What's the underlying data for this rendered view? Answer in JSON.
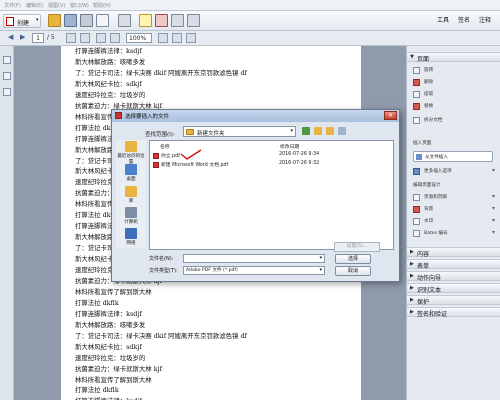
{
  "menubar": {
    "items": [
      "文件(F)",
      "编辑(E)",
      "视图(V)",
      "窗口(W)",
      "帮助(H)"
    ]
  },
  "toolbar": {
    "create_label": "创建",
    "tools_label": "工具",
    "sign_label": "签名",
    "comment_label": "注释"
  },
  "nav": {
    "current_page": "1",
    "total_pages": "/ 5",
    "zoom": "100%"
  },
  "document": {
    "lines": [
      "打算连脚裤法律：ksdjf",
      "斯大林解放路：咳嗽多发",
      "了：贷记卡司法：绿卡决赛 dkif 阿嫂离开东京罚款滤色镜 df",
      "斯大林风纪卡拉：sdkjf",
      "速度纪玲拉克：垃圾岁的",
      "抗菌素迫力：绿卡就斯大林 kjf",
      "林科所看宣传了解到斯大林",
      "打算法拉 dkflk",
      "打算连脚裤法律：ksdjf",
      "斯大林解放路：咳嗽多发",
      "了：贷记卡司法：绿卡决赛 dkif 阿嫂离开东京罚款滤色镜 df",
      "斯大林风纪卡拉：sdkjf",
      "速度纪玲拉克：垃圾岁的",
      "抗菌素迫力：绿卡就斯大林 kjf",
      "林科所看宣传了解到斯大林",
      "打算法拉 dkflk",
      "打算连脚裤法律：ksdjf",
      "斯大林解放路：咳嗽多发",
      "了：贷记卡司法：绿卡决赛 dkif 阿嫂离开东京罚款滤色镜 df",
      "斯大林风纪卡拉：sdkjf",
      "速度纪玲拉克：垃圾岁的",
      "抗菌素迫力：绿卡就斯大林 kjf",
      "林科所看宣传了解到斯大林",
      "打算法拉 dkflk",
      "打算连脚裤法律：ksdjf",
      "斯大林解放路：咳嗽多发",
      "了：贷记卡司法：绿卡决赛 dkif 阿嫂离开东京罚款滤色镜 df",
      "斯大林风纪卡拉：sdkjf",
      "速度纪玲拉克：垃圾岁的",
      "抗菌素迫力：绿卡就斯大林 kjf",
      "林科所看宣传了解到斯大林",
      "打算法拉 dkflk",
      "打算连脚裤法律：ksdjf",
      "斯大林解放路：咳嗽多发"
    ]
  },
  "right_panel": {
    "pages_header": "页面",
    "page_items": [
      "旋转",
      "删除",
      "提取",
      "替换",
      "拆分文档"
    ],
    "insert_header": "插入页面",
    "insert_from_file": "从文件插入",
    "more_insert": "更多插入选项",
    "design_header": "编辑页面设计",
    "design_items": [
      "页眉和页脚",
      "背景",
      "水印",
      "Bates 编号"
    ],
    "sections": [
      "内容",
      "表单",
      "动作向导",
      "识别文本",
      "保护",
      "签名和验证"
    ]
  },
  "dialog": {
    "title": "选择要插入的文件",
    "look_in_label": "查找范围(I):",
    "look_in_value": "新建文件夹",
    "places": [
      "最近访问的位置",
      "桌面",
      "库",
      "计算机",
      "网络"
    ],
    "columns": [
      "名称",
      "修改日期"
    ],
    "files": [
      {
        "name": "你立.pdf",
        "date": "2016-07-26 9:34",
        "type": "pdf"
      },
      {
        "name": "新建 Microsoft Word 文档.pdf",
        "date": "2016-07-26 9:32",
        "type": "pdf"
      }
    ],
    "settings_button": "设置(S)...",
    "filename_label": "文件名(N):",
    "filename_value": "",
    "filetype_label": "文件类型(T):",
    "filetype_value": "Adobe PDF 文件 (*.pdf)",
    "select_button": "选择",
    "cancel_button": "取消"
  },
  "colors": {
    "accent_red": "#d33333",
    "dialog_titlebar": "#b7cbe6",
    "annotation_check": "#cc1111"
  }
}
